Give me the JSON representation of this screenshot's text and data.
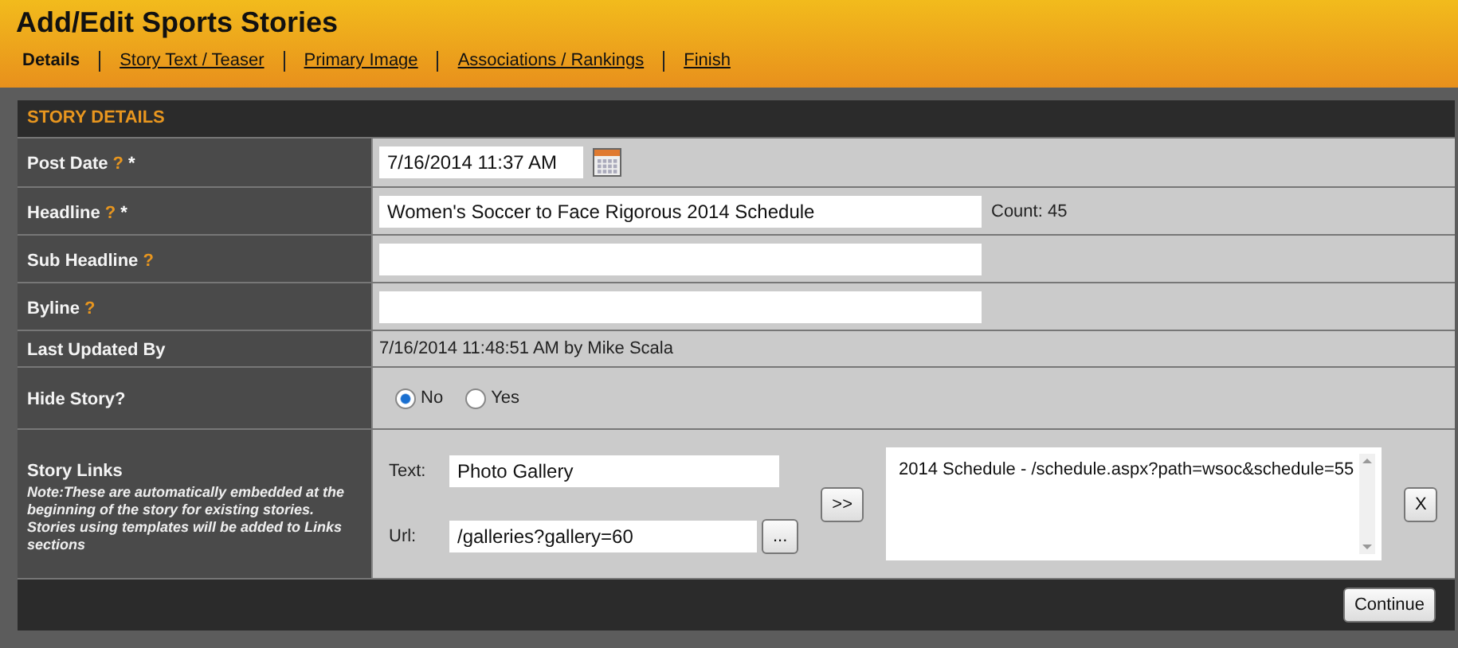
{
  "page": {
    "title": "Add/Edit Sports Stories"
  },
  "tabs": [
    {
      "label": "Details",
      "selected": true
    },
    {
      "label": "Story Text / Teaser",
      "selected": false
    },
    {
      "label": "Primary Image",
      "selected": false
    },
    {
      "label": "Associations / Rankings",
      "selected": false
    },
    {
      "label": "Finish",
      "selected": false
    }
  ],
  "panel": {
    "title": "STORY DETAILS",
    "rows": [
      {
        "kind": "date",
        "label": "Post Date",
        "help_mark": "?",
        "required_mark": "*",
        "value": "7/16/2014 11:37 AM"
      },
      {
        "kind": "text",
        "label": "Headline",
        "help_mark": "?",
        "required_mark": "*",
        "value": "Women's Soccer to Face Rigorous 2014 Schedule",
        "count": "Count: 45"
      },
      {
        "kind": "text",
        "label": "Sub Headline",
        "help_mark": "?"
      },
      {
        "kind": "text",
        "label": "Byline",
        "help_mark": "?"
      },
      {
        "kind": "static",
        "label": "Last Updated By",
        "value": "7/16/2014 11:48:51 AM by Mike Scala"
      },
      {
        "kind": "radio",
        "label": "Hide Story?",
        "options": [
          {
            "label": "No",
            "selected": true
          },
          {
            "label": "Yes",
            "selected": false
          }
        ]
      },
      {
        "kind": "links",
        "label": "Story Links",
        "note": "Note:These are automatically embedded at the beginning of the story for existing stories. Stories using templates will be added to Links sections",
        "text_label": "Text:",
        "text_value": "Photo Gallery",
        "url_label": "Url:",
        "url_value": "/galleries?gallery=60",
        "browse_button": "...",
        "add_button": ">>",
        "links": [
          "2014 Schedule - /schedule.aspx?path=wsoc&schedule=55"
        ],
        "remove_button": "X"
      }
    ],
    "continue_button": "Continue"
  }
}
